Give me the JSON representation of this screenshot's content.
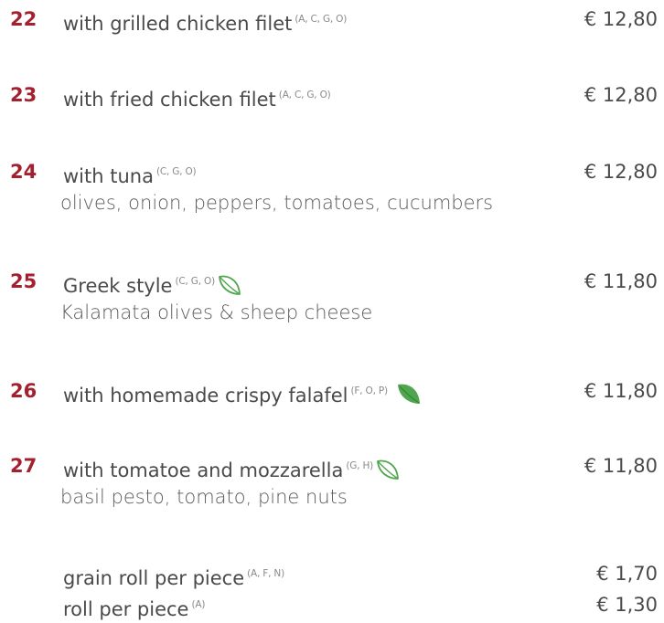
{
  "items": [
    {
      "number": "22",
      "name": "with grilled chicken filet",
      "allergens": "(A, C, G, O)",
      "price": "€ 12,80",
      "description": "",
      "icon": ""
    },
    {
      "number": "23",
      "name": "with fried chicken filet",
      "allergens": "(A, C, G, O)",
      "price": "€ 12,80",
      "description": "",
      "icon": ""
    },
    {
      "number": "24",
      "name": "with tuna",
      "allergens": "(C, G, O)",
      "price": "€ 12,80",
      "description": "olives, onion, peppers, tomatoes, cucumbers",
      "icon": ""
    },
    {
      "number": "25",
      "name": "Greek style",
      "allergens": "(C, G, O)",
      "price": "€ 11,80",
      "description": "Kalamata olives & sheep cheese",
      "icon": "vegetarian-leaf-outline-icon"
    },
    {
      "number": "26",
      "name": "with homemade crispy falafel",
      "allergens": "(F, O, P)",
      "price": "€ 11,80",
      "description": "",
      "icon": "vegan-leaf-filled-icon"
    },
    {
      "number": "27",
      "name": "with tomatoe and mozzarella",
      "allergens": "(G, H)",
      "price": "€ 11,80",
      "description": "basil pesto, tomato, pine nuts",
      "icon": "vegetarian-leaf-outline-icon"
    }
  ],
  "extras": [
    {
      "name": "grain roll per piece",
      "allergens": "(A, F, N)",
      "price": "€ 1,70"
    },
    {
      "name": "roll per piece",
      "allergens": "(A)",
      "price": "€ 1,30"
    }
  ],
  "colors": {
    "number": "#a3212f",
    "text": "#4a4a4a",
    "allergen": "#8a8a8a",
    "leaf": "#4fa64f"
  }
}
